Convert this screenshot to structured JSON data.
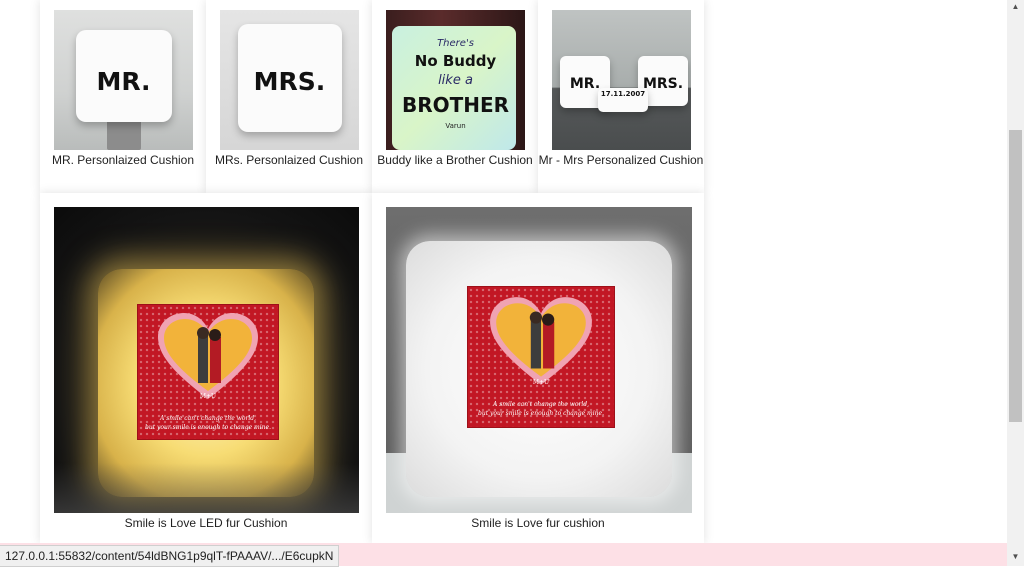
{
  "products": {
    "row1": [
      {
        "name": "MR. Personlaized Cushion",
        "image_text": "MR."
      },
      {
        "name": "MRs. Personlaized Cushion",
        "image_text": "MRS."
      },
      {
        "name": "Buddy like a Brother Cushion",
        "image_text": {
          "line1": "There's",
          "line2": "No Buddy",
          "line3": "like a",
          "line4": "BROTHER",
          "line5": "Varun"
        }
      },
      {
        "name": "Mr - Mrs Personalized Cushion",
        "image_text": {
          "left": "MR.",
          "right": "MRS.",
          "date": "17.11.2007"
        }
      }
    ],
    "row2": [
      {
        "name": "Smile is Love LED fur Cushion",
        "image_text": {
          "initials": "M+U",
          "quote1": "A smile can't change the world,",
          "quote2": "but your smile is enough to change mine."
        }
      },
      {
        "name": "Smile is Love fur cushion",
        "image_text": {
          "initials": "M+U",
          "quote1": "A smile can't change the world,",
          "quote2": "but your smile is enough to change mine."
        }
      }
    ]
  },
  "status_bar": {
    "url": "127.0.0.1:55832/content/54ldBNG1p9qlT-fPAAAV/.../E6cupkN"
  },
  "scrollbar": {
    "up_icon": "triangle-up-icon",
    "down_icon": "triangle-down-icon"
  },
  "colors": {
    "status_bg": "#fde0e6",
    "panel_red": "#c21724"
  }
}
